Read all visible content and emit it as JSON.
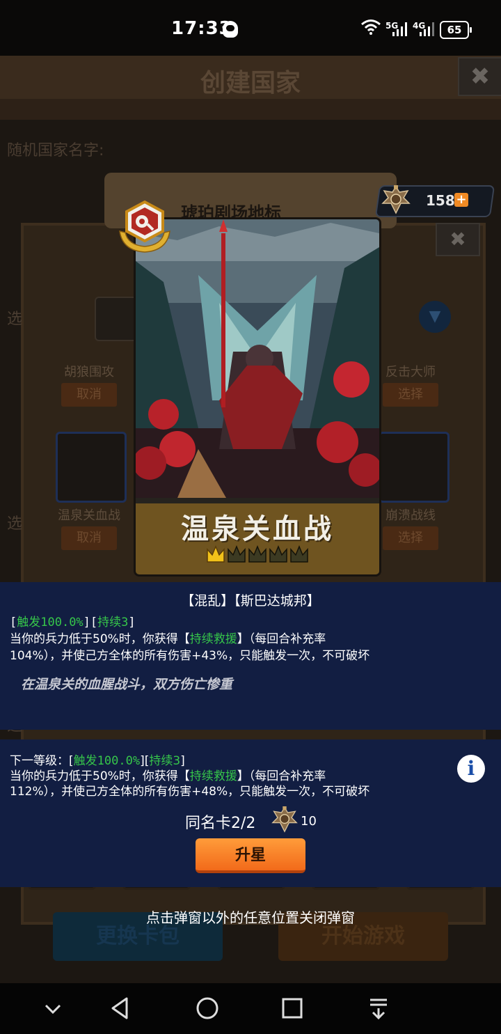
{
  "status_bar": {
    "time": "17:33",
    "network1": "5G",
    "network2": "4G",
    "battery": "65",
    "icons": [
      "qq-icon",
      "wifi-icon",
      "signal-icon",
      "battery-icon"
    ]
  },
  "background": {
    "title": "创建国家",
    "random_name_label": "随机国家名字:",
    "panel_title": "琥珀剧场地标",
    "side_labels": [
      "选",
      "选",
      "选"
    ],
    "cards": [
      {
        "label": "胡狼围攻",
        "button": "取消"
      },
      {
        "label": "反击大师",
        "button": "选择"
      },
      {
        "label": "温泉关血战",
        "button": "取消"
      },
      {
        "label": "崩溃战线",
        "button": "选择"
      }
    ],
    "bottom_buttons": {
      "swap": "更换卡包",
      "start": "开始游戏"
    }
  },
  "currency": {
    "value": "158",
    "plus": "+"
  },
  "card": {
    "name": "温泉关血战",
    "stars_filled": 1,
    "stars_total": 5
  },
  "info": {
    "factions": "【混乱】【斯巴达城邦】",
    "current": {
      "tag_open1": "[",
      "trigger": "触发100.0%",
      "tag_mid": "][",
      "duration": "持续3",
      "tag_close": "]",
      "line2_pre": "当你的兵力低于50%时，你获得【",
      "buff": "持续救援",
      "line2_post": "】（每回合补充率",
      "line3": "104%），并使己方全体的所有伤害+43%，只能触发一次，不可破坏"
    },
    "flavor": "在温泉关的血腥战斗，双方伤亡惨重",
    "next": {
      "prefix": "下一等级：[",
      "trigger": "触发100.0%",
      "tag_mid": "][",
      "duration": "持续3",
      "tag_close": "]",
      "line2_pre": "当你的兵力低于50%时，你获得【",
      "buff": "持续救援",
      "line2_post": "】（每回合补充率",
      "line3": "112%），并使己方全体的所有伤害+48%，只能触发一次，不可破坏"
    },
    "duplicate": "同名卡2/2",
    "upgrade_cost": "10",
    "upgrade_button": "升星",
    "close_hint": "点击弹窗以外的任意位置关闭弹窗"
  },
  "colors": {
    "accent_green": "#36c64a",
    "panel_blue": "#121e42",
    "button_orange": "#f26a1a"
  }
}
